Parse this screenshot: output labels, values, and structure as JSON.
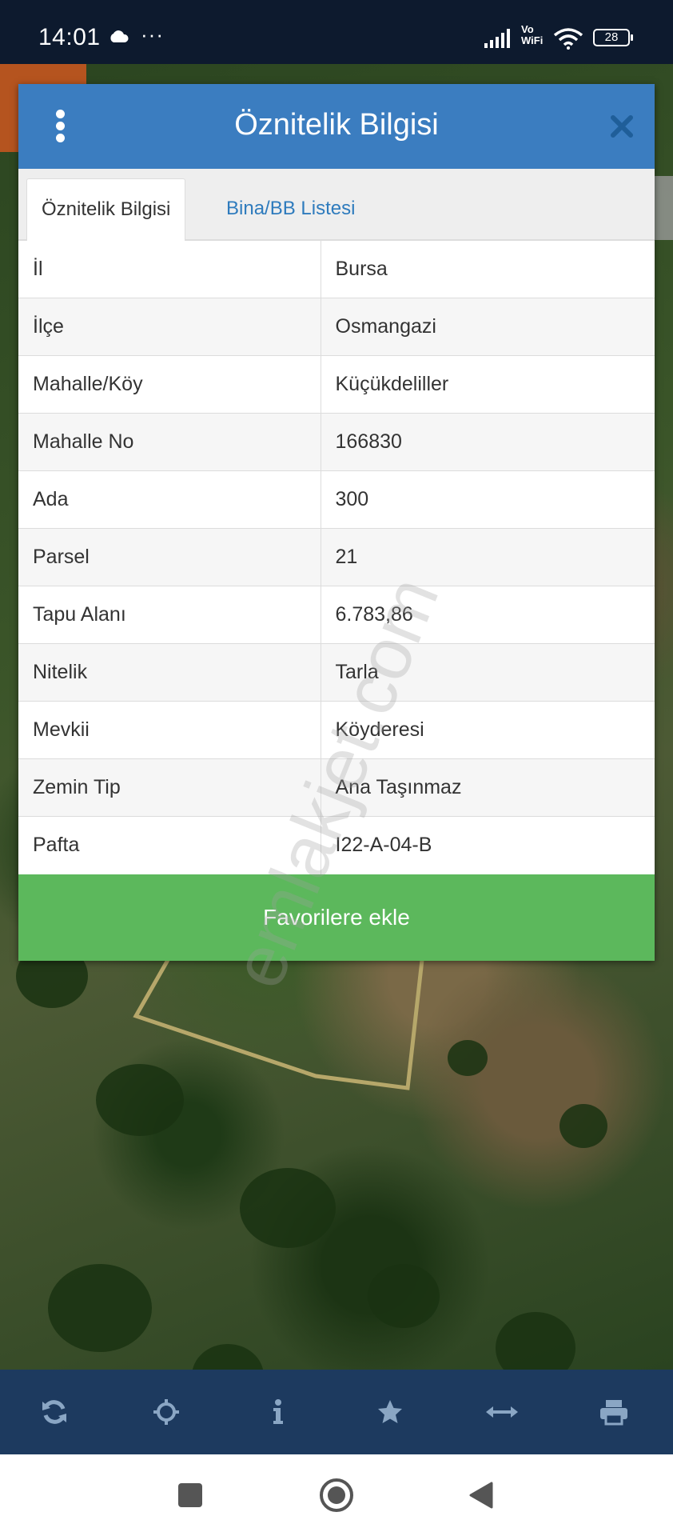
{
  "status_bar": {
    "time": "14:01",
    "more": "···",
    "network_label_top": "Vo",
    "network_label_bottom": "WiFi",
    "battery": "28"
  },
  "dialog": {
    "title": "Öznitelik Bilgisi",
    "menu_icon": "kebab-menu-icon",
    "close_icon": "close-icon",
    "tabs": [
      {
        "label": "Öznitelik Bilgisi",
        "active": true
      },
      {
        "label": "Bina/BB Listesi",
        "active": false
      }
    ],
    "rows": [
      {
        "key": "İl",
        "value": "Bursa"
      },
      {
        "key": "İlçe",
        "value": "Osmangazi"
      },
      {
        "key": "Mahalle/Köy",
        "value": "Küçükdeliller"
      },
      {
        "key": "Mahalle No",
        "value": "166830"
      },
      {
        "key": "Ada",
        "value": "300"
      },
      {
        "key": "Parsel",
        "value": "21"
      },
      {
        "key": "Tapu Alanı",
        "value": "6.783,86"
      },
      {
        "key": "Nitelik",
        "value": "Tarla"
      },
      {
        "key": "Mevkii",
        "value": "Köyderesi"
      },
      {
        "key": "Zemin Tip",
        "value": "Ana Taşınmaz"
      },
      {
        "key": "Pafta",
        "value": "I22-A-04-B"
      }
    ],
    "favorite_button": "Favorilere ekle"
  },
  "watermark": "emlakjet.com",
  "toolbar": {
    "icons": [
      "refresh-icon",
      "locate-crosshair-icon",
      "info-icon",
      "star-icon",
      "measure-arrows-icon",
      "print-icon"
    ]
  },
  "navbar": {
    "icons": [
      "recents-square-icon",
      "home-circle-icon",
      "back-triangle-icon"
    ]
  },
  "colors": {
    "header": "#3b7dc0",
    "favorite_button": "#5cb85c",
    "toolbar": "#1d3a5f",
    "status_bar": "#0d1a2e",
    "tab_link": "#2e7bbd"
  }
}
